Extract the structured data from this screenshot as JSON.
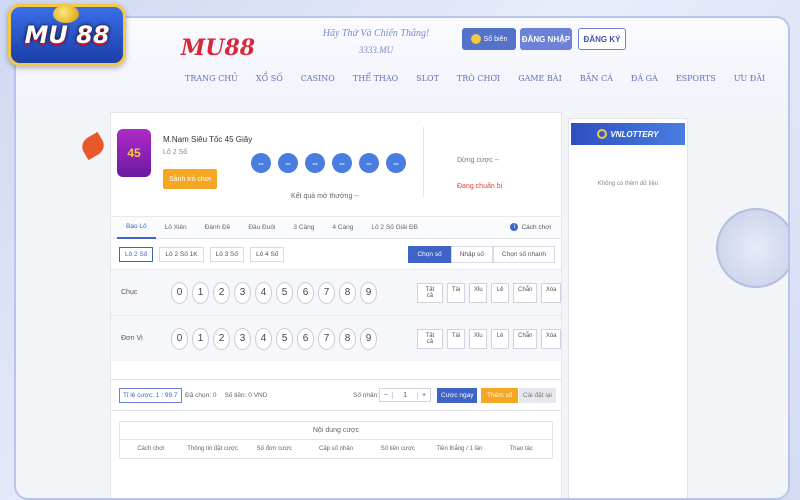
{
  "logo": {
    "text": "MU 88"
  },
  "header": {
    "brand": "MU88",
    "slogan_line1": "Hãy Thử Và Chiến Thắng!",
    "slogan_line2": "3333.MU",
    "sobien_label": "Sổ biên",
    "login_label": "ĐĂNG NHẬP",
    "register_label": "ĐĂNG KÝ"
  },
  "nav": [
    "TRANG CHỦ",
    "XỔ SỐ",
    "CASINO",
    "THỂ THAO",
    "SLOT",
    "TRÒ CHƠI",
    "GAME BÀI",
    "BẮN CÁ",
    "ĐÁ GÀ",
    "ESPORTS",
    "ƯU ĐÃI"
  ],
  "game": {
    "badge": "45",
    "title": "M.Nam Siêu Tốc 45 Giây",
    "subtitle": "Lô 2 Số",
    "play_label": "Sảnh trò chơi",
    "balls": [
      "--",
      "--",
      "--",
      "--",
      "--",
      "--"
    ],
    "result_label": "Kết quả mở thưởng --",
    "stop_label": "Dừng cược --",
    "status_label": "Đang chuẩn bị"
  },
  "tabs": [
    "Bao Lô",
    "Lô Xiên",
    "Đánh Đề",
    "Đầu Đuôi",
    "3 Càng",
    "4 Càng",
    "Lô 2 Số Giải ĐB"
  ],
  "howto_label": "Cách chơi",
  "subtabs": [
    "Lô 2 Số",
    "Lô 2 Số 1K",
    "Lô 3 Số",
    "Lô 4 Số"
  ],
  "modes": [
    "Chọn số",
    "Nhập số",
    "Chọn số nhanh"
  ],
  "rows": [
    {
      "label": "Chục"
    },
    {
      "label": "Đơn Vị"
    }
  ],
  "digits": [
    "0",
    "1",
    "2",
    "3",
    "4",
    "5",
    "6",
    "7",
    "8",
    "9"
  ],
  "quick_buttons": [
    "Tất cả",
    "Tài",
    "Xỉu",
    "Lẻ",
    "Chẵn",
    "Xóa"
  ],
  "bet": {
    "odds": "Tỉ lệ cược: 1 : 99.7",
    "selected": "Đã chọn: 0",
    "amount": "Số tiền: 0 VND",
    "multiplier_label": "Số nhân:",
    "minus": "−",
    "multiplier_value": "1",
    "plus": "+",
    "bet_now": "Cược ngay",
    "add_ticket": "Thêm số",
    "reset": "Cài đặt lại"
  },
  "table": {
    "title": "Nội dung cược",
    "headers": [
      "Cách chơi",
      "Thông tin đặt cược",
      "Số đơn cược",
      "Cấp số nhân",
      "Số tiền cược",
      "Tiền thắng / 1 lần",
      "Thao tác"
    ]
  },
  "side": {
    "logo_text": "VNLOTTERY",
    "empty_text": "Không có thêm dữ liệu"
  },
  "colors": {
    "primary": "#3e64c8",
    "accent": "#f5a623",
    "danger": "#e0463b",
    "frame_border": "#b9c4ea"
  }
}
